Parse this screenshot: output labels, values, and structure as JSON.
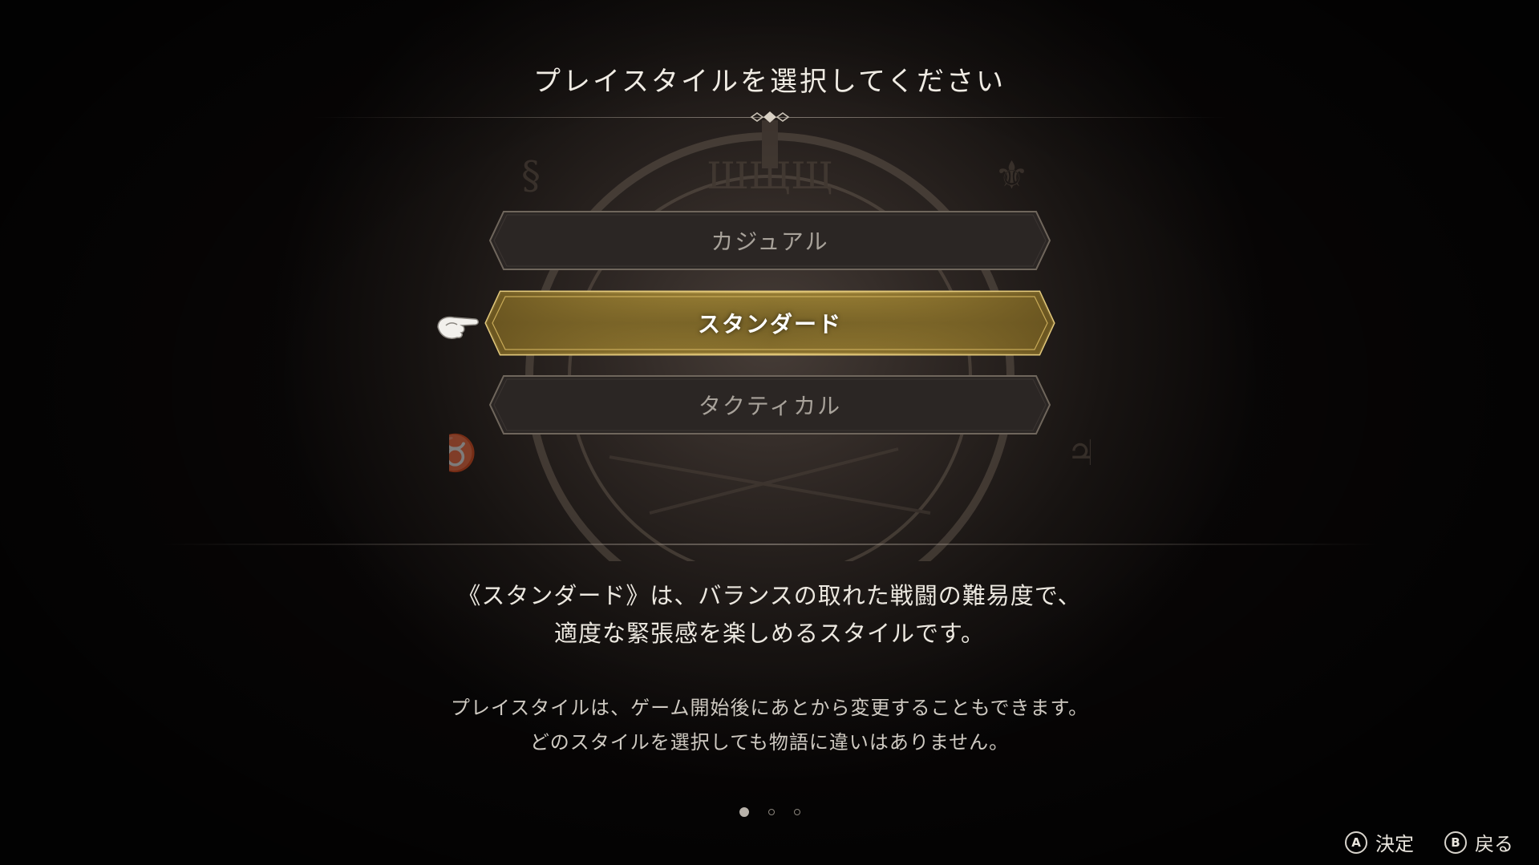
{
  "header": {
    "title": "プレイスタイルを選択してください"
  },
  "options": [
    {
      "label": "カジュアル",
      "selected": false
    },
    {
      "label": "スタンダード",
      "selected": true
    },
    {
      "label": "タクティカル",
      "selected": false
    }
  ],
  "description": {
    "line1": "《スタンダード》は、バランスの取れた戦闘の難易度で、",
    "line2": "適度な緊張感を楽しめるスタイルです。"
  },
  "note": {
    "line1": "プレイスタイルは、ゲーム開始後にあとから変更することもできます。",
    "line2": "どのスタイルを選択しても物語に違いはありません。"
  },
  "pager": {
    "current": 1,
    "total": 3
  },
  "hints": {
    "confirm": {
      "button": "A",
      "label": "決定",
      "icon": "a-button-icon"
    },
    "back": {
      "button": "B",
      "label": "戻る",
      "icon": "b-button-icon"
    }
  },
  "colors": {
    "selected_gold": "#b8963a",
    "unselected_fill": "#2a2524",
    "background": "#0a0808"
  }
}
